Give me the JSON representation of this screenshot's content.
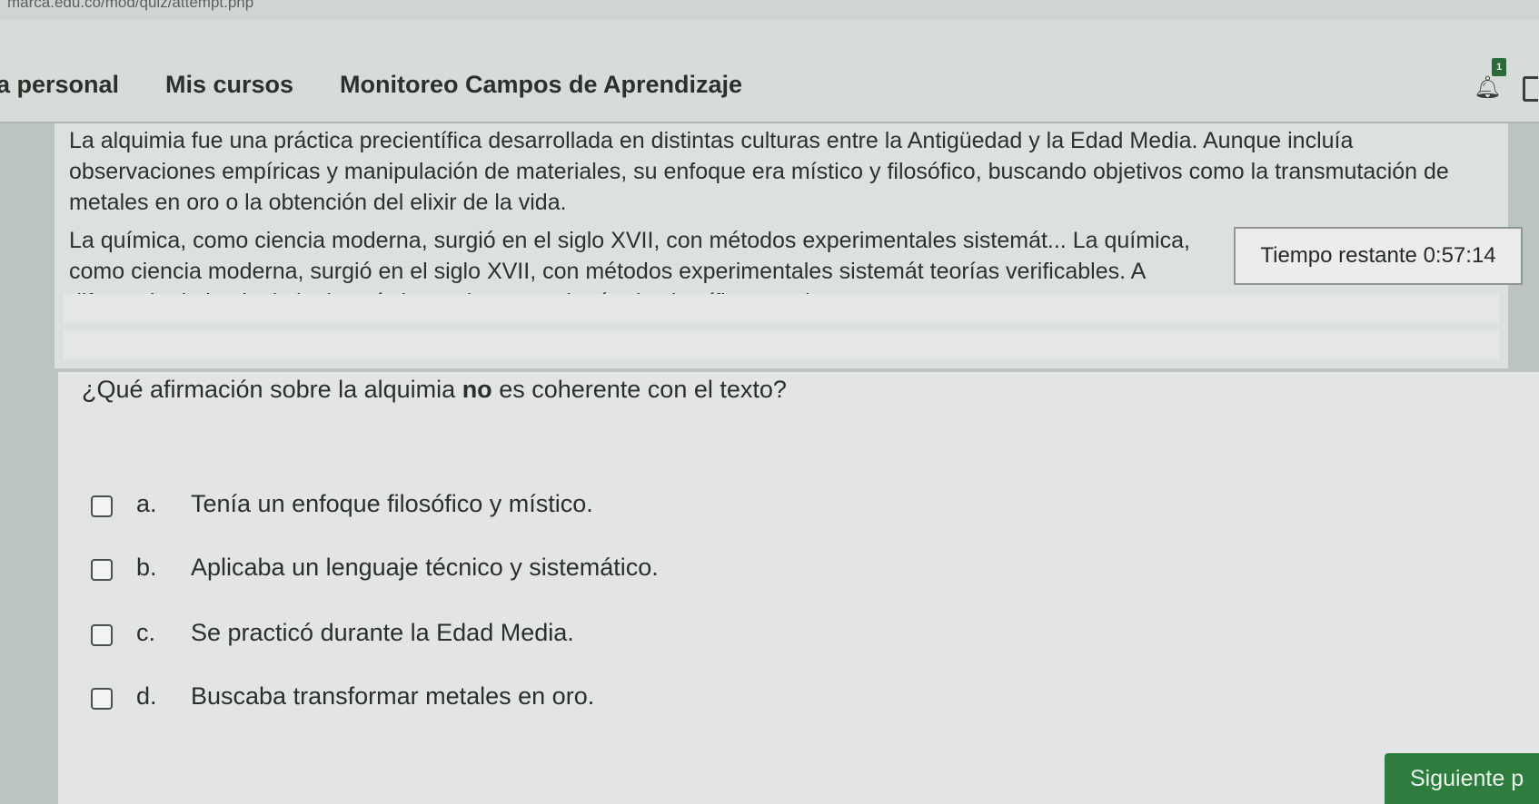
{
  "browser": {
    "url_fragment": "marca.edu.co/mod/quiz/attempt.php"
  },
  "nav": {
    "items": [
      "a personal",
      "Mis cursos",
      "Monitoreo Campos de Aprendizaje"
    ],
    "notification_count": "1"
  },
  "passage": {
    "paragraph1": "La alquimia fue una práctica precientífica desarrollada en distintas culturas entre la Antigüedad y la Edad Media. Aunque incluía observaciones empíricas y manipulación de materiales, su enfoque era místico y filosófico, buscando objetivos como la transmutación de metales en oro o la obtención del elixir de la vida.",
    "paragraph2": "La química, como ciencia moderna, surgió en el siglo XVII, con métodos experimentales sistemát... La química, como ciencia moderna, surgió en el siglo XVII, con métodos experimentales sistemát teorías verificables. A diferencia de la alquimia, la química se basa en el método científico y en le"
  },
  "timer": {
    "label": "Tiempo restante",
    "value": "0:57:14"
  },
  "question": {
    "prefix": "¿Qué afirmación sobre la alquimia ",
    "emphasis": "no",
    "suffix": " es coherente con el texto?",
    "options": [
      {
        "letter": "a.",
        "text": "Tenía un enfoque filosófico y místico."
      },
      {
        "letter": "b.",
        "text": "Aplicaba un lenguaje técnico y sistemático."
      },
      {
        "letter": "c.",
        "text": "Se practicó durante la Edad Media."
      },
      {
        "letter": "d.",
        "text": "Buscaba transformar metales en oro."
      }
    ]
  },
  "footer": {
    "next_label": "Siguiente p"
  }
}
